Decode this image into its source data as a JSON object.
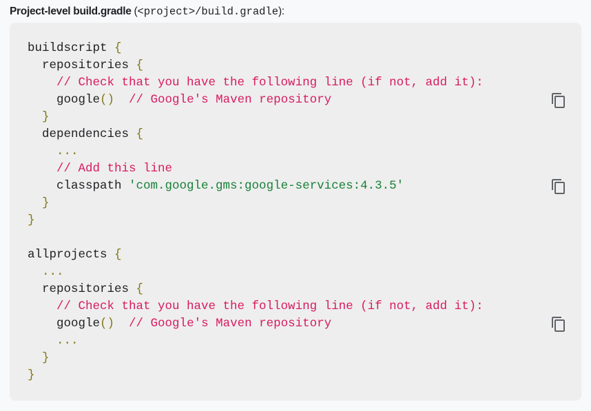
{
  "caption": {
    "bold": "Project-level build.gradle",
    "open": " (",
    "path": "<project>/build.gradle",
    "close": "):"
  },
  "code_lines": [
    [
      [
        "plain",
        "buildscript "
      ],
      [
        "brace",
        "{"
      ]
    ],
    [
      [
        "plain",
        "  repositories "
      ],
      [
        "brace",
        "{"
      ]
    ],
    [
      [
        "comment",
        "    // Check that you have the following line (if not, add it):"
      ]
    ],
    [
      [
        "plain",
        "    google"
      ],
      [
        "brace",
        "()"
      ],
      [
        "comment",
        "  // Google's Maven repository"
      ]
    ],
    [
      [
        "brace",
        "  }"
      ]
    ],
    [
      [
        "plain",
        "  dependencies "
      ],
      [
        "brace",
        "{"
      ]
    ],
    [
      [
        "brace",
        "    ..."
      ]
    ],
    [
      [
        "comment",
        "    // Add this line"
      ]
    ],
    [
      [
        "plain",
        "    classpath "
      ],
      [
        "string",
        "'com.google.gms:google-services:4.3.5'"
      ]
    ],
    [
      [
        "brace",
        "  }"
      ]
    ],
    [
      [
        "brace",
        "}"
      ]
    ],
    [],
    [
      [
        "plain",
        "allprojects "
      ],
      [
        "brace",
        "{"
      ]
    ],
    [
      [
        "brace",
        "  ..."
      ]
    ],
    [
      [
        "plain",
        "  repositories "
      ],
      [
        "brace",
        "{"
      ]
    ],
    [
      [
        "comment",
        "    // Check that you have the following line (if not, add it):"
      ]
    ],
    [
      [
        "plain",
        "    google"
      ],
      [
        "brace",
        "()"
      ],
      [
        "comment",
        "  // Google's Maven repository"
      ]
    ],
    [
      [
        "brace",
        "    ..."
      ]
    ],
    [
      [
        "brace",
        "  }"
      ]
    ],
    [
      [
        "brace",
        "}"
      ]
    ]
  ],
  "copy_buttons_on_lines": [
    3,
    8,
    16
  ],
  "colors": {
    "comment": "#d81b60",
    "string": "#188038",
    "brace": "#827717",
    "plain": "#202124"
  }
}
